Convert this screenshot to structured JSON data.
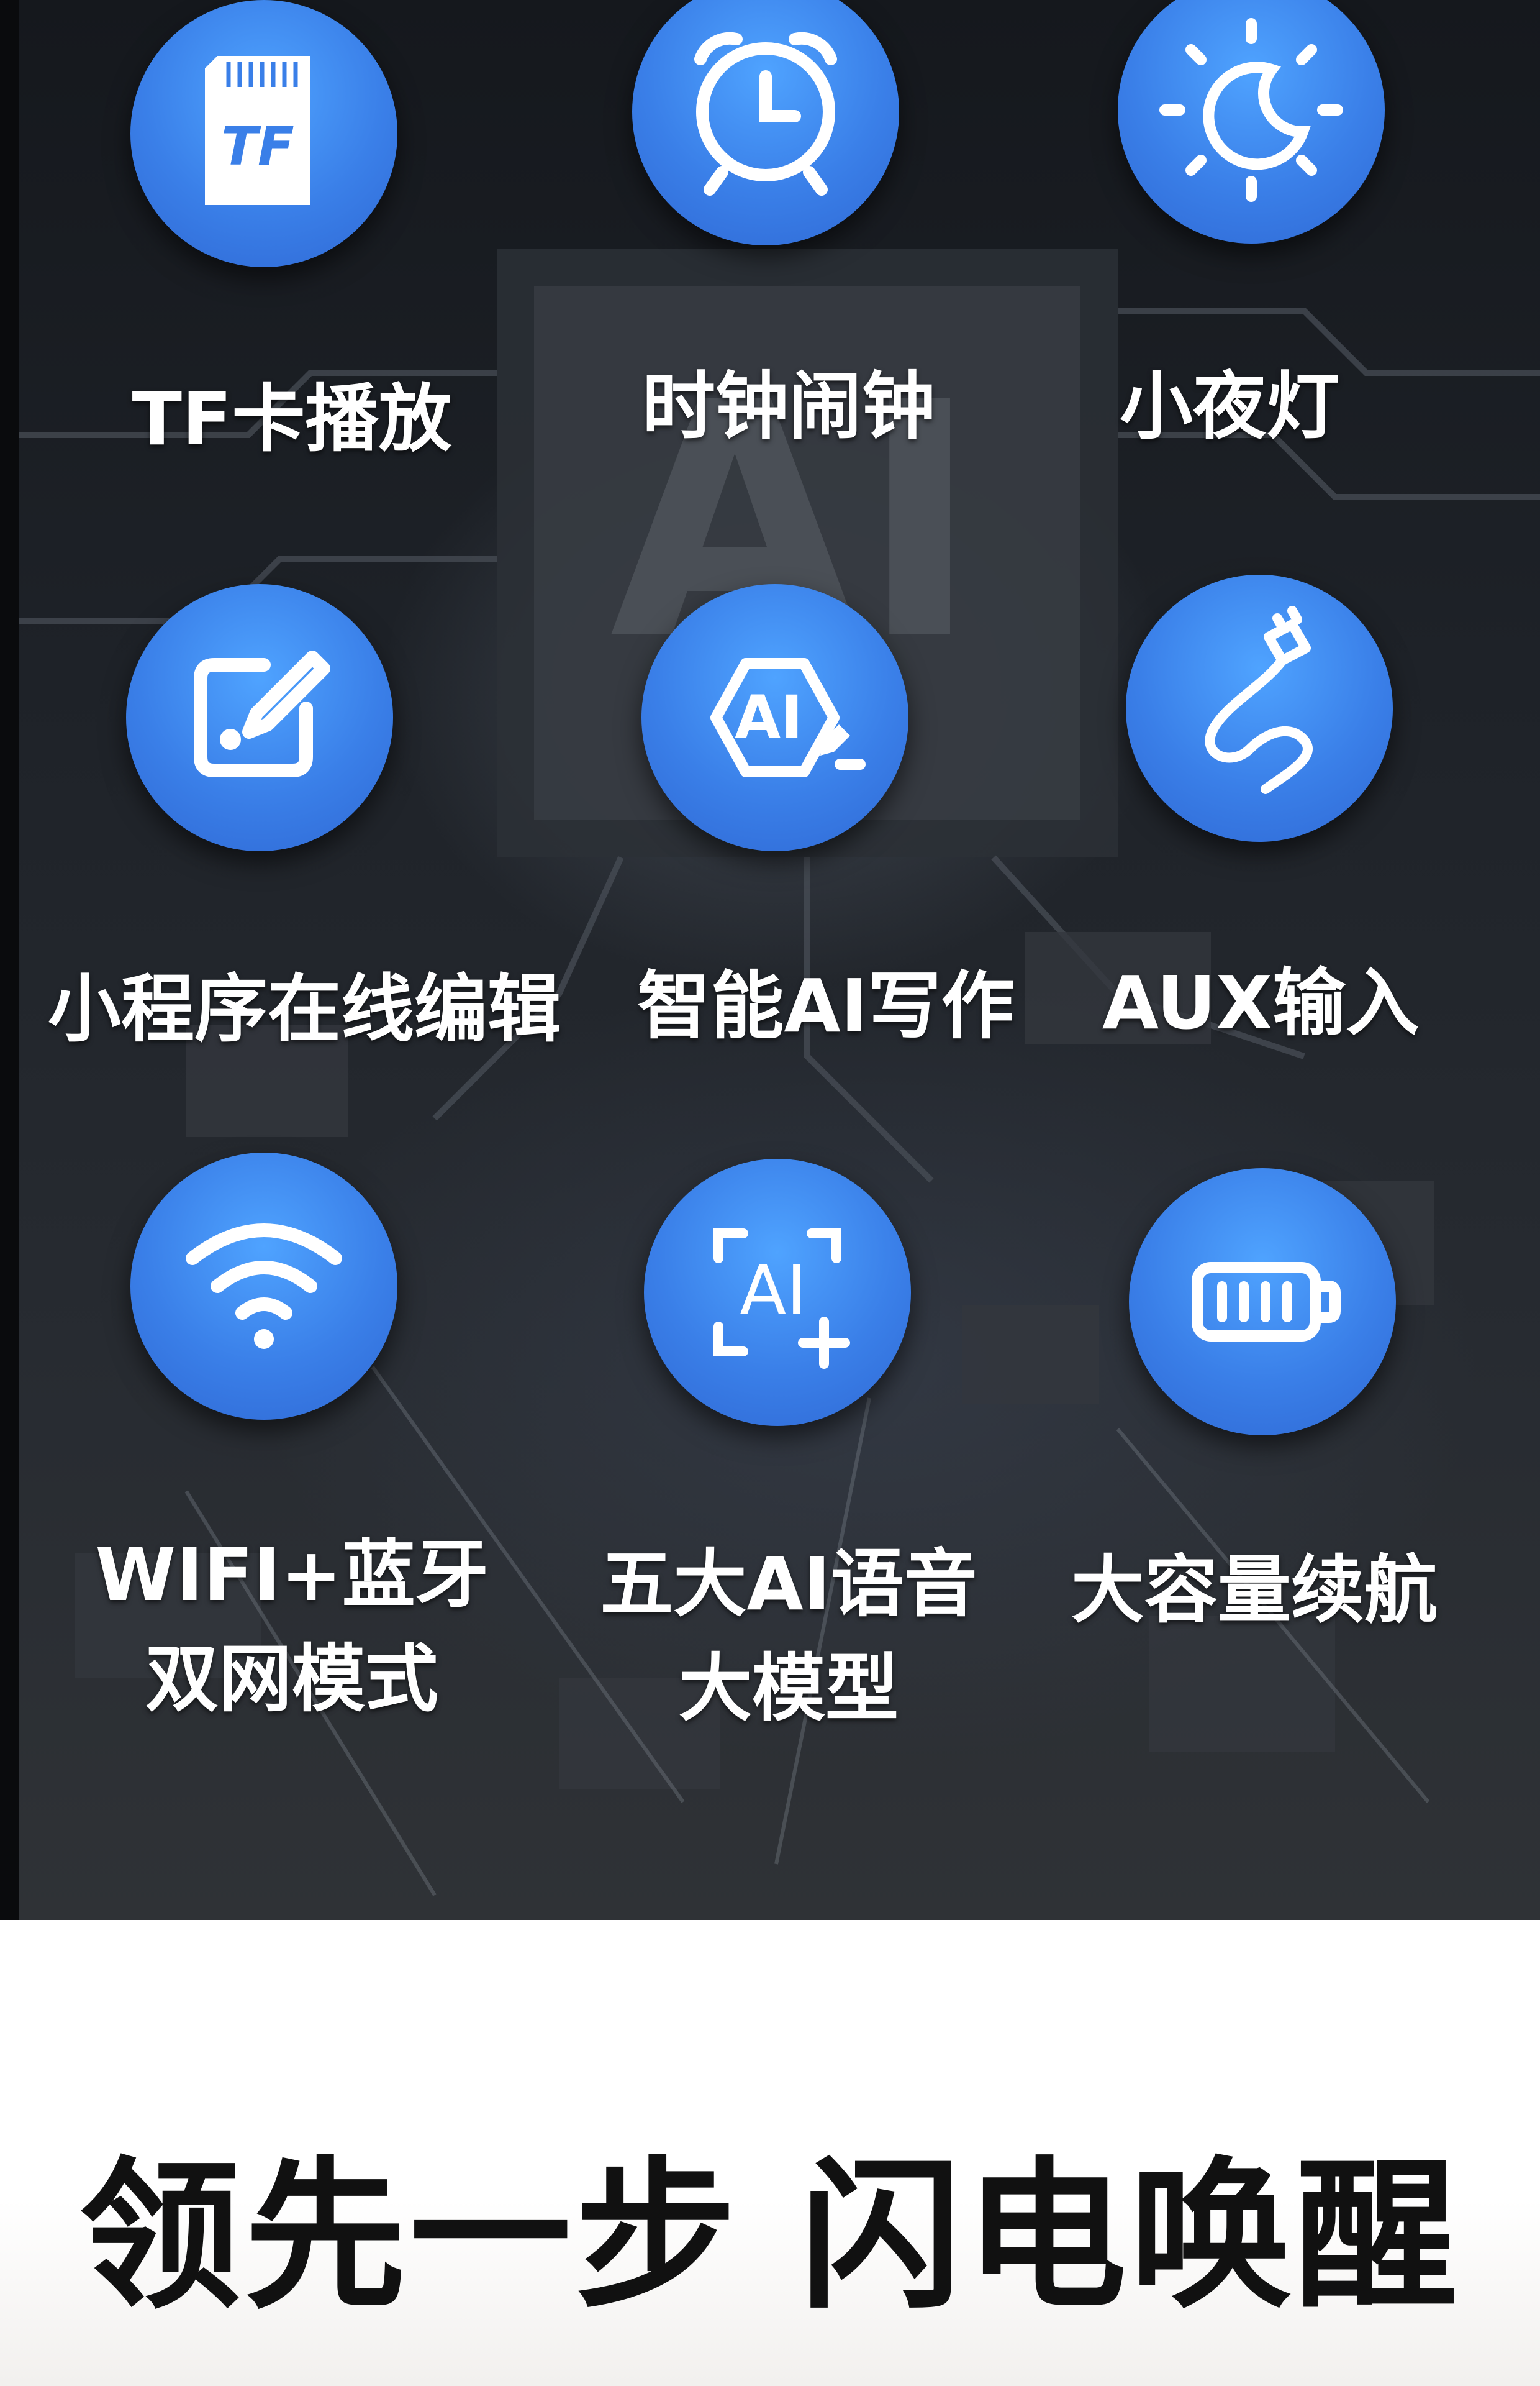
{
  "features": [
    {
      "label": "TF卡播放",
      "icon": "tf-card-icon"
    },
    {
      "label": "时钟闹钟",
      "icon": "alarm-clock-icon"
    },
    {
      "label": "小夜灯",
      "icon": "night-light-icon"
    },
    {
      "label": "小程序在线编辑",
      "icon": "edit-icon"
    },
    {
      "label": "智能AI写作",
      "icon": "ai-writing-icon"
    },
    {
      "label": "AUX输入",
      "icon": "aux-cable-icon"
    },
    {
      "label": "WIFI+蓝牙\n双网模式",
      "icon": "wifi-icon"
    },
    {
      "label": "五大AI语音\n大模型",
      "icon": "ai-scan-icon"
    },
    {
      "label": "大容量续航",
      "icon": "battery-icon"
    }
  ],
  "tf_icon_text": "TF",
  "ai_icon_text": "AI",
  "ai_scan_icon_text": "AI",
  "chip_watermark": "AI",
  "headline": "领先一步 闪电唤醒",
  "colors": {
    "icon_blue": "#3a7fe8",
    "panel_dark": "#1e2228",
    "headline": "#111111"
  }
}
